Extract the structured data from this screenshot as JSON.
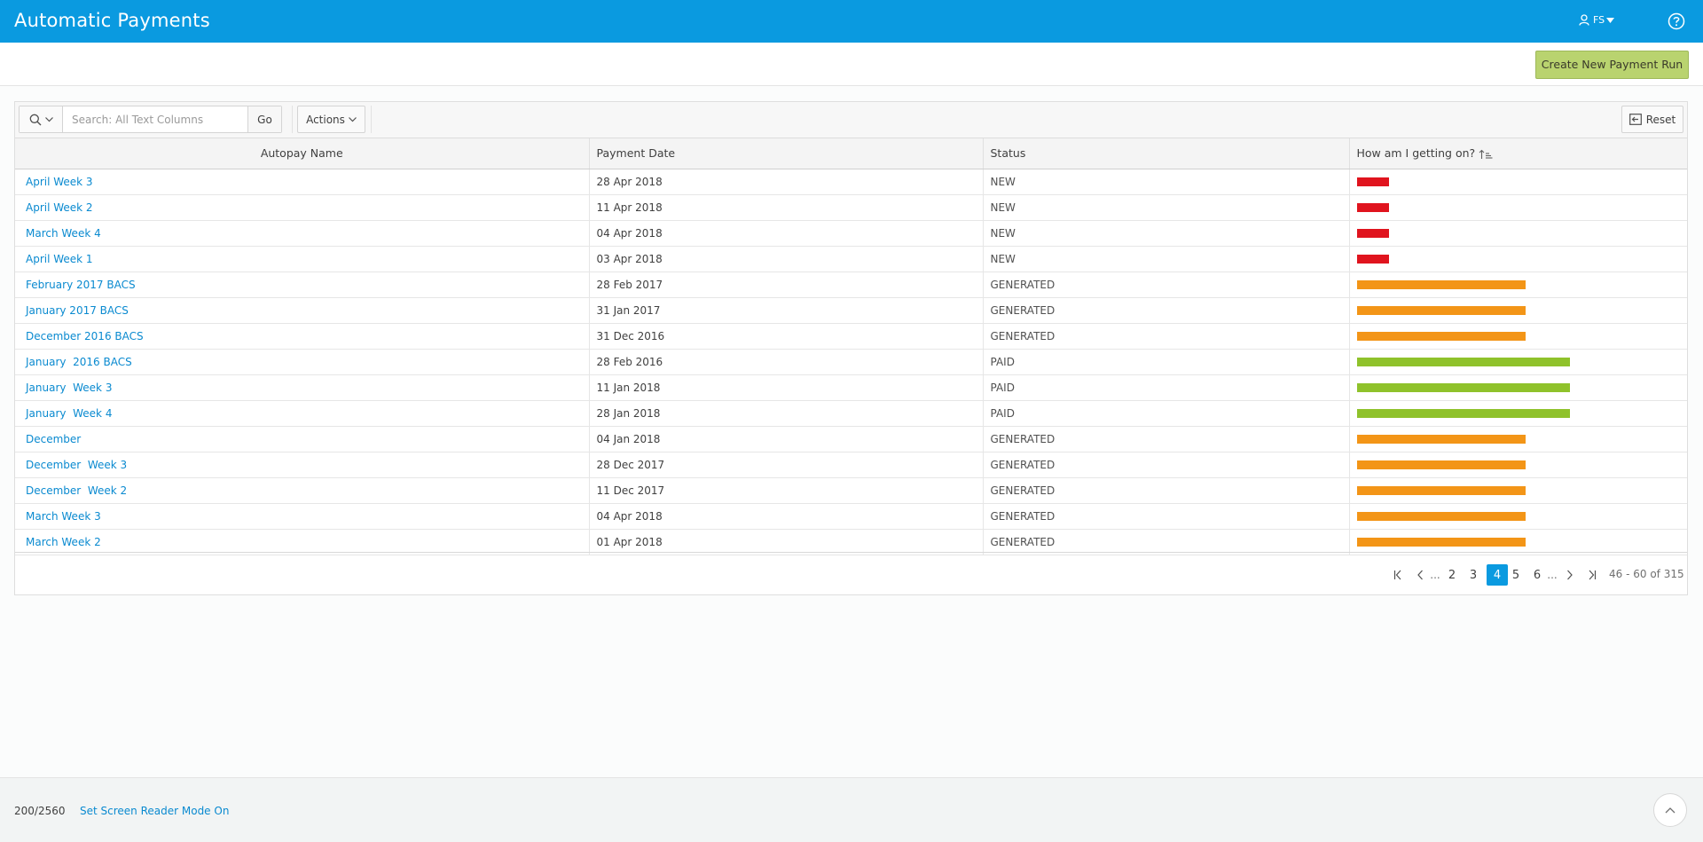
{
  "header": {
    "title": "Automatic Payments",
    "user_initials": "FS",
    "user_icon": "user-icon",
    "help_icon": "help-icon",
    "brand_color": "#0a9ae0"
  },
  "button_bar": {
    "create_label": "Create New Payment Run",
    "create_color": "#b9d36f"
  },
  "toolbar": {
    "search_placeholder": "Search: All Text Columns",
    "search_value": "",
    "go_label": "Go",
    "actions_label": "Actions",
    "reset_label": "Reset"
  },
  "table": {
    "columns": [
      "Autopay Name",
      "Payment Date",
      "Status",
      "How am I getting on?"
    ],
    "status_colors": {
      "NEW": "#e0141e",
      "GENERATED": "#f39517",
      "PAID": "#8fc22b"
    },
    "rows": [
      {
        "name": "April Week 3",
        "date": "28 Apr 2018",
        "status": "NEW",
        "progress": 0.15
      },
      {
        "name": "April Week 2",
        "date": "11 Apr 2018",
        "status": "NEW",
        "progress": 0.15
      },
      {
        "name": "March Week 4",
        "date": "04 Apr 2018",
        "status": "NEW",
        "progress": 0.15
      },
      {
        "name": "April Week 1",
        "date": "03 Apr 2018",
        "status": "NEW",
        "progress": 0.15
      },
      {
        "name": "February 2017 BACS",
        "date": "28 Feb 2017",
        "status": "GENERATED",
        "progress": 0.79
      },
      {
        "name": "January 2017 BACS",
        "date": "31 Jan 2017",
        "status": "GENERATED",
        "progress": 0.79
      },
      {
        "name": "December 2016 BACS",
        "date": "31 Dec 2016",
        "status": "GENERATED",
        "progress": 0.79
      },
      {
        "name": "January  2016 BACS",
        "date": "28 Feb 2016",
        "status": "PAID",
        "progress": 1.0
      },
      {
        "name": "January  Week 3",
        "date": "11 Jan 2018",
        "status": "PAID",
        "progress": 1.0
      },
      {
        "name": "January  Week 4",
        "date": "28 Jan 2018",
        "status": "PAID",
        "progress": 1.0
      },
      {
        "name": "December",
        "date": "04 Jan 2018",
        "status": "GENERATED",
        "progress": 0.79
      },
      {
        "name": "December  Week 3",
        "date": "28 Dec 2017",
        "status": "GENERATED",
        "progress": 0.79
      },
      {
        "name": "December  Week 2",
        "date": "11 Dec 2017",
        "status": "GENERATED",
        "progress": 0.79
      },
      {
        "name": "March Week 3",
        "date": "04 Apr 2018",
        "status": "GENERATED",
        "progress": 0.79
      },
      {
        "name": "March Week 2",
        "date": "01 Apr 2018",
        "status": "GENERATED",
        "progress": 0.79
      }
    ]
  },
  "pagination": {
    "ellipsis": "...",
    "pages": [
      "2",
      "3",
      "4",
      "5",
      "6"
    ],
    "current_page": "4",
    "range_text": "46 - 60 of 315"
  },
  "footer": {
    "version": "200/2560",
    "screen_reader_link": "Set Screen Reader Mode On"
  }
}
